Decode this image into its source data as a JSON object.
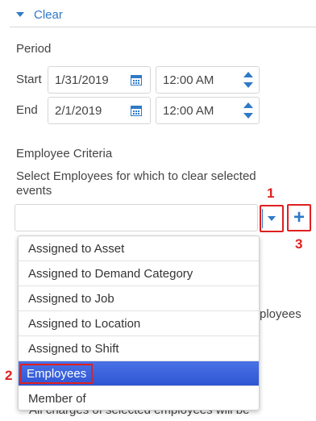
{
  "section": {
    "title": "Clear"
  },
  "period": {
    "label": "Period",
    "start_label": "Start",
    "start_date": "1/31/2019",
    "start_time": "12:00 AM",
    "end_label": "End",
    "end_date": "2/1/2019",
    "end_time": "12:00 AM"
  },
  "employee_criteria": {
    "label": "Employee Criteria",
    "description": "Select Employees for which to clear selected events",
    "combo_value": ""
  },
  "dropdown": {
    "options": [
      "Assigned to Asset",
      "Assigned to Demand Category",
      "Assigned to Job",
      "Assigned to Location",
      "Assigned to Shift",
      "Employees",
      "Member of"
    ],
    "selected": "Employees"
  },
  "background_text": {
    "partial_right": "ployees",
    "partial_bottom": "All charges of selected employees will be"
  },
  "annotations": {
    "dropdown_button": "1",
    "employees_option": "2",
    "add_button": "3"
  },
  "colors": {
    "accent": "#2f7ac6",
    "highlight": "#e02020",
    "selection": "#3a62dc"
  }
}
